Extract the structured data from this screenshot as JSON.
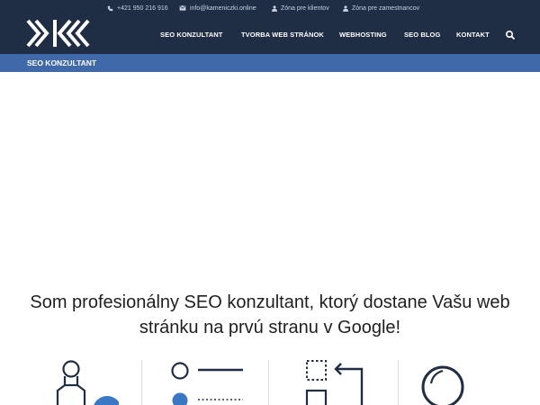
{
  "topbar": {
    "phone": "+421 950 216 916",
    "email": "info@kameniczki.online",
    "client_zone": "Zóna pre klientov",
    "staff_zone": "Zóna pre zamestnancov"
  },
  "nav": {
    "items": [
      {
        "label": "SEO KONZULTANT"
      },
      {
        "label": "TVORBA WEB STRÁNOK"
      },
      {
        "label": "WEBHOSTING"
      },
      {
        "label": "SEO BLOG"
      },
      {
        "label": "KONTAKT"
      }
    ]
  },
  "page_title": "SEO KONZULTANT",
  "headline": {
    "line1": "Som profesionálny SEO konzultant, ktorý dostane Vašu web",
    "line2": "stránku na prvú stranu v Google!"
  },
  "colors": {
    "header_bg": "#1f2e45",
    "title_bar_bg": "#3f69a9",
    "icon_dark": "#1f2e45",
    "icon_blue": "#3a78c5"
  },
  "icons": [
    "phone-icon",
    "envelope-icon",
    "user-icon",
    "user-icon",
    "search-icon",
    "seo-person-icon",
    "list-icon",
    "layout-arrows-icon",
    "magnifier-circle-icon"
  ]
}
